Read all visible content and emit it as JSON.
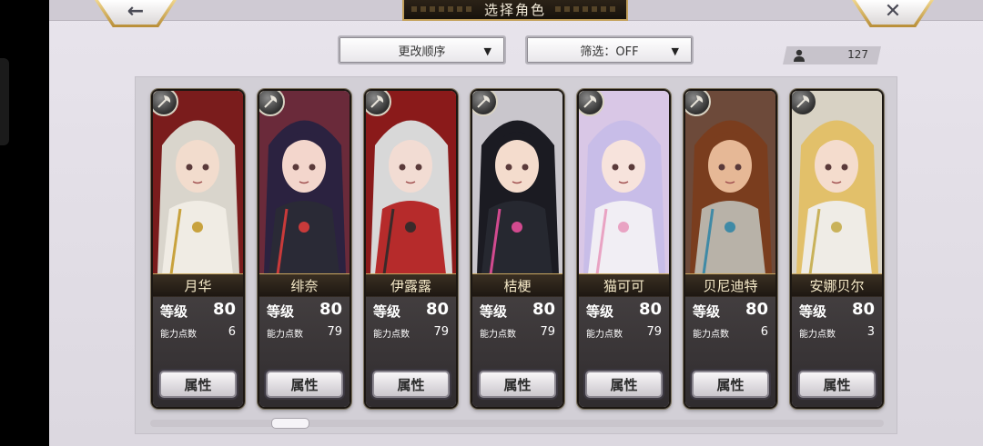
{
  "header": {
    "title": "选择角色",
    "back_icon": "←",
    "close_icon": "✕"
  },
  "controls": {
    "order_label": "更改顺序",
    "filter_label": "筛选：OFF",
    "caret": "▼",
    "count": "127"
  },
  "labels": {
    "level": "等级",
    "ability_points": "能力点数",
    "attribute_button": "属性"
  },
  "characters": [
    {
      "name": "月华",
      "level": "80",
      "points": "6",
      "weapon_icon": "axe-icon"
    },
    {
      "name": "绯奈",
      "level": "80",
      "points": "79",
      "weapon_icon": "axe-icon"
    },
    {
      "name": "伊露露",
      "level": "80",
      "points": "79",
      "weapon_icon": "axe-icon"
    },
    {
      "name": "桔梗",
      "level": "80",
      "points": "79",
      "weapon_icon": "axe-icon"
    },
    {
      "name": "猫可可",
      "level": "80",
      "points": "79",
      "weapon_icon": "axe-icon"
    },
    {
      "name": "贝尼迪特",
      "level": "80",
      "points": "6",
      "weapon_icon": "axe-icon"
    },
    {
      "name": "安娜贝尔",
      "level": "80",
      "points": "3",
      "weapon_icon": "axe-icon"
    }
  ],
  "colors": {
    "accent_gold": "#c9a760",
    "banner_dark": "#2a2219",
    "background": "#dcd8e0"
  }
}
